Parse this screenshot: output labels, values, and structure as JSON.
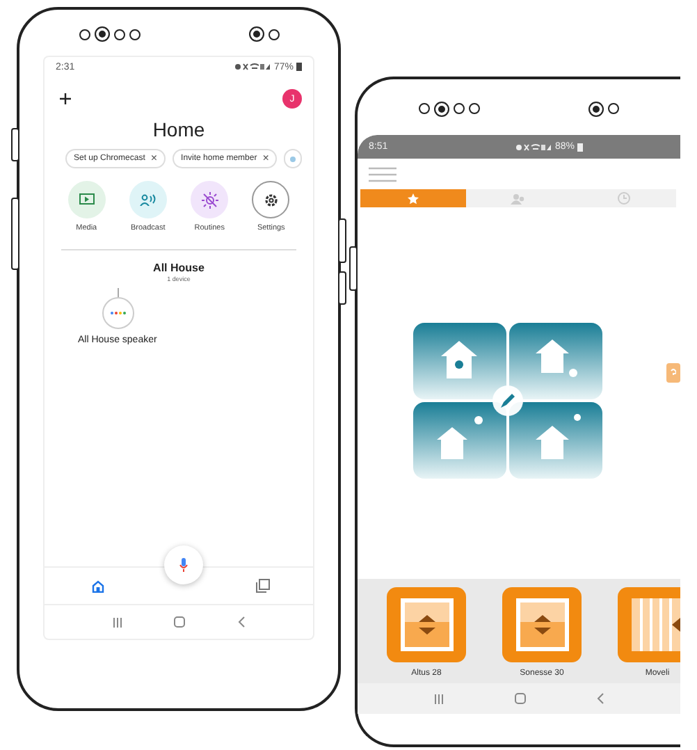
{
  "home_app": {
    "status_bar": {
      "time": "2:31",
      "battery": "77%"
    },
    "avatar": "J",
    "title": "Home",
    "chips": [
      {
        "label": "Set up Chromecast",
        "close": "×"
      },
      {
        "label": "Invite home member",
        "close": "×"
      }
    ],
    "actions": [
      {
        "kind": "media",
        "label": "Media"
      },
      {
        "kind": "broadcast",
        "label": "Broadcast"
      },
      {
        "kind": "routines",
        "label": "Routines"
      },
      {
        "kind": "settings",
        "label": "Settings"
      }
    ],
    "room": {
      "name": "All House",
      "count": "1 device"
    },
    "device": "All House speaker",
    "nav": [
      {
        "kind": "home",
        "selected": true
      },
      {
        "kind": "feed",
        "selected": false
      }
    ]
  },
  "blinds_app": {
    "status_bar": {
      "time": "8:51",
      "battery": "88%"
    },
    "tabs": [
      {
        "kind": "favorites",
        "selected": true
      },
      {
        "kind": "group",
        "selected": false
      },
      {
        "kind": "clock",
        "selected": false
      }
    ],
    "devices": [
      {
        "kind": "roller",
        "name": "Altus 28"
      },
      {
        "kind": "roller",
        "name": "Sonesse 30"
      },
      {
        "kind": "vertical",
        "name": "Moveli"
      }
    ]
  }
}
